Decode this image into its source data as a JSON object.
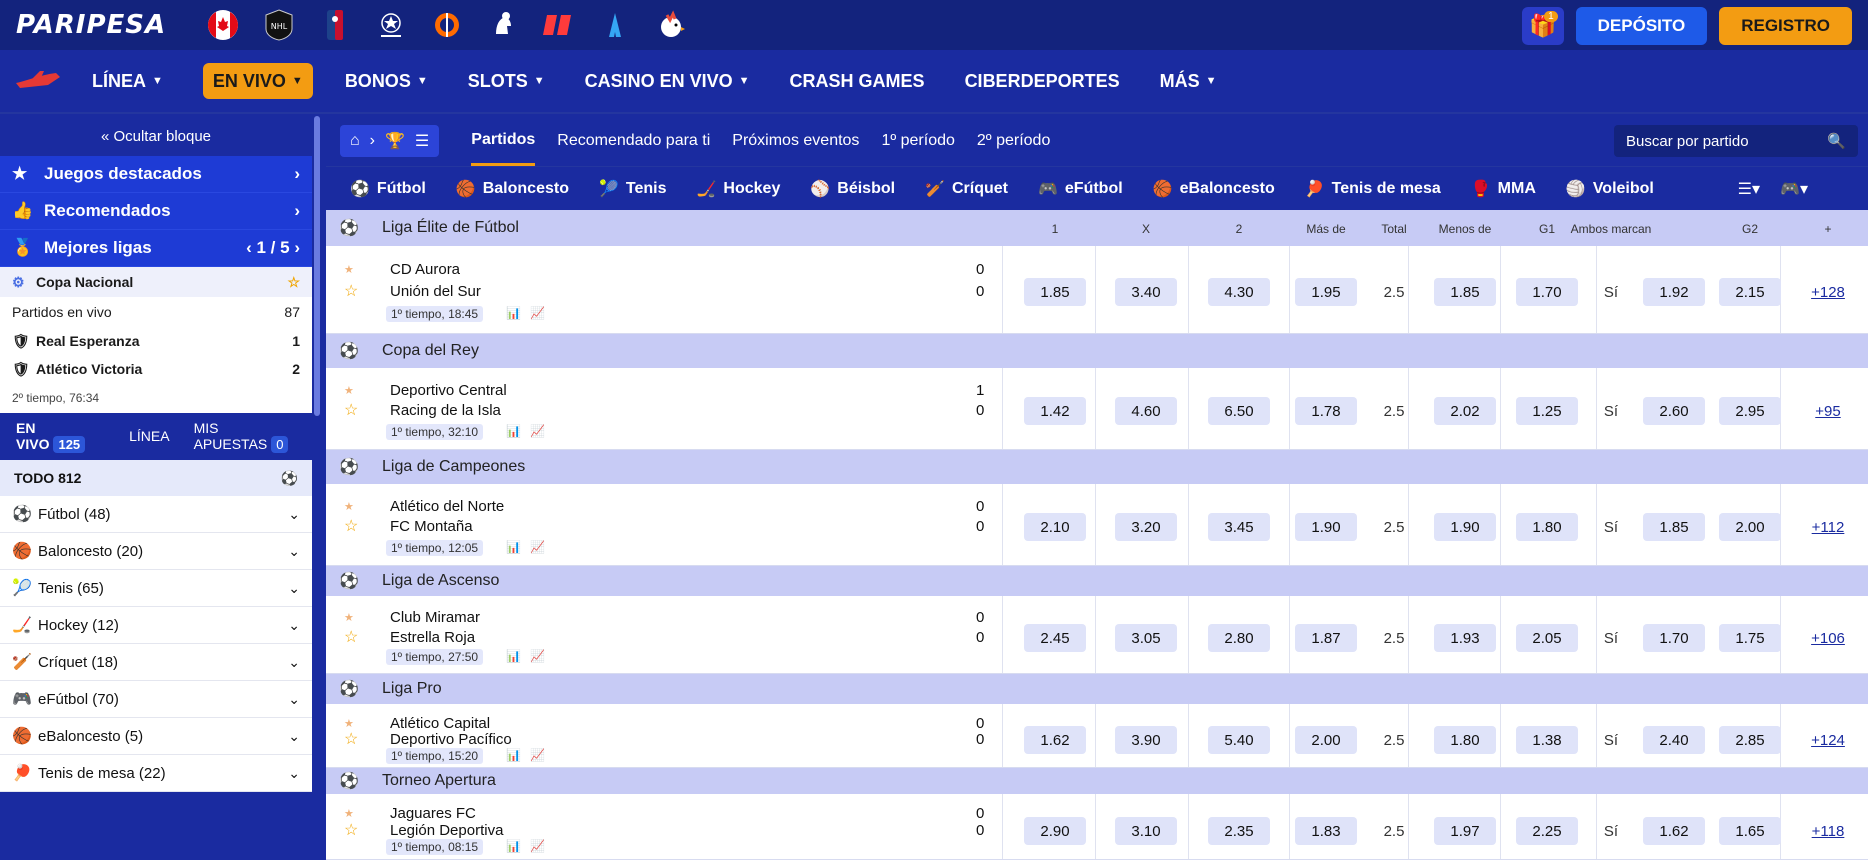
{
  "header": {
    "brand": "PARIPESA",
    "gift_badge": "1",
    "deposit": "DEPÓSITO",
    "register": "REGISTRO"
  },
  "nav": [
    {
      "label": "LÍNEA",
      "chev": true
    },
    {
      "label": "EN VIVO",
      "chev": true,
      "active": true
    },
    {
      "label": "BONOS",
      "chev": true
    },
    {
      "label": "SLOTS",
      "chev": true
    },
    {
      "label": "CASINO EN VIVO",
      "chev": true
    },
    {
      "label": "CRASH GAMES",
      "chev": false
    },
    {
      "label": "CIBERDEPORTES",
      "chev": false
    },
    {
      "label": "MÁS",
      "chev": true
    }
  ],
  "sidebar": {
    "hide": "« Ocultar bloque",
    "featured": "Juegos destacados",
    "recommended": "Recomendados",
    "best": "Mejores ligas",
    "best_page": "1 / 5",
    "cup": "Copa Nacional",
    "live_matches": "Partidos en vivo",
    "live_count": "87",
    "team1": "Real Esperanza",
    "score1": "1",
    "team2": "Atlético Victoria",
    "score2": "2",
    "time": "2º tiempo, 76:34",
    "tab_live": "EN VIVO",
    "tab_live_count": "125",
    "tab_line": "LÍNEA",
    "tab_bets": "MIS APUESTAS",
    "tab_bets_count": "0",
    "all": "TODO 812",
    "sports": [
      {
        "icon": "⚽",
        "label": "Fútbol (48)"
      },
      {
        "icon": "🏀",
        "label": "Baloncesto (20)"
      },
      {
        "icon": "🎾",
        "label": "Tenis (65)"
      },
      {
        "icon": "🏒",
        "label": "Hockey (12)"
      },
      {
        "icon": "🏏",
        "label": "Críquet (18)"
      },
      {
        "icon": "🎮",
        "label": "eFútbol (70)"
      },
      {
        "icon": "🏀",
        "label": "eBaloncesto (5)"
      },
      {
        "icon": "🏓",
        "label": "Tenis de mesa (22)"
      }
    ]
  },
  "main": {
    "tabs": [
      "Partidos",
      "Recomendado para ti",
      "Próximos eventos",
      "1º período",
      "2º período"
    ],
    "search_placeholder": "Buscar por partido",
    "sports": [
      "Fútbol",
      "Baloncesto",
      "Tenis",
      "Hockey",
      "Béisbol",
      "Críquet",
      "eFútbol",
      "eBaloncesto",
      "Tenis de mesa",
      "MMA",
      "Voleibol"
    ],
    "cols": [
      "1",
      "X",
      "2",
      "Más de",
      "Total",
      "Menos de",
      "G1",
      "Ambos marcan",
      "G2",
      "+"
    ],
    "leagues": [
      {
        "name": "Liga Élite de Fútbol",
        "t1": "CD Aurora",
        "t2": "Unión del Sur",
        "s1": "0",
        "s2": "0",
        "time": "1º tiempo, 18:45",
        "odds": [
          "1.85",
          "3.40",
          "4.30",
          "1.95",
          "2.5",
          "1.85",
          "1.70",
          "Sí",
          "1.92",
          "2.15"
        ],
        "more": "+128"
      },
      {
        "name": "Copa del Rey",
        "t1": "Deportivo Central",
        "t2": "Racing de la Isla",
        "s1": "1",
        "s2": "0",
        "time": "1º tiempo, 32:10",
        "odds": [
          "1.42",
          "4.60",
          "6.50",
          "1.78",
          "2.5",
          "2.02",
          "1.25",
          "Sí",
          "2.60",
          "2.95"
        ],
        "more": "+95"
      },
      {
        "name": "Liga de Campeones",
        "t1": "Atlético del Norte",
        "t2": "FC Montaña",
        "s1": "0",
        "s2": "0",
        "time": "1º tiempo, 12:05",
        "odds": [
          "2.10",
          "3.20",
          "3.45",
          "1.90",
          "2.5",
          "1.90",
          "1.80",
          "Sí",
          "1.85",
          "2.00"
        ],
        "more": "+112"
      },
      {
        "name": "Liga de Ascenso",
        "t1": "Club Miramar",
        "t2": "Estrella Roja",
        "s1": "0",
        "s2": "0",
        "time": "1º tiempo, 27:50",
        "odds": [
          "2.45",
          "3.05",
          "2.80",
          "1.87",
          "2.5",
          "1.93",
          "2.05",
          "Sí",
          "1.70",
          "1.75"
        ],
        "more": "+106"
      },
      {
        "name": "Liga Pro",
        "t1": "Atlético Capital",
        "t2": "Deportivo Pacífico",
        "s1": "0",
        "s2": "0",
        "time": "1º tiempo, 15:20",
        "odds": [
          "1.62",
          "3.90",
          "5.40",
          "2.00",
          "2.5",
          "1.80",
          "1.38",
          "Sí",
          "2.40",
          "2.85"
        ],
        "more": "+124"
      },
      {
        "name": "Torneo Apertura",
        "t1": "Jaguares FC",
        "t2": "Legión Deportiva",
        "s1": "0",
        "s2": "0",
        "time": "1º tiempo, 08:15",
        "odds": [
          "2.90",
          "3.10",
          "2.35",
          "1.83",
          "2.5",
          "1.97",
          "2.25",
          "Sí",
          "1.62",
          "1.65"
        ],
        "more": "+118"
      }
    ]
  }
}
